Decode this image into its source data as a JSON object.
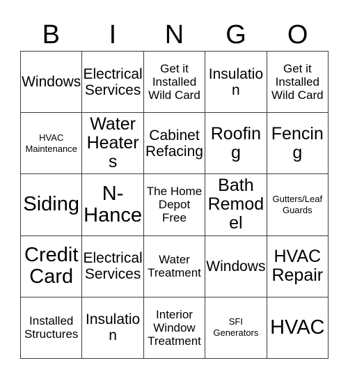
{
  "card": {
    "title": "Bingo Card",
    "header_letters": [
      "B",
      "I",
      "N",
      "G",
      "O"
    ],
    "colors": {
      "background": "#ffffff",
      "text": "#000000",
      "grid_line": "#3b3b3b"
    },
    "rows": [
      [
        {
          "text": "Windows",
          "size": "md"
        },
        {
          "text": "Electrical\nServices",
          "size": "md"
        },
        {
          "text": "Get it\nInstalled\nWild Card",
          "size": "sm"
        },
        {
          "text": "Insulation",
          "size": "md"
        },
        {
          "text": "Get it\nInstalled\nWild Card",
          "size": "sm"
        }
      ],
      [
        {
          "text": "HVAC\nMaintenance",
          "size": "xs"
        },
        {
          "text": "Water\nHeaters",
          "size": "lg"
        },
        {
          "text": "Cabinet\nRefacing",
          "size": "md"
        },
        {
          "text": "Roofing",
          "size": "lg"
        },
        {
          "text": "Fencing",
          "size": "lg"
        }
      ],
      [
        {
          "text": "Siding",
          "size": "xl"
        },
        {
          "text": "N-\nHance",
          "size": "xl"
        },
        {
          "text": "The Home\nDepot\nFree",
          "size": "sm"
        },
        {
          "text": "Bath\nRemodel",
          "size": "lg"
        },
        {
          "text": "Gutters/Leaf\nGuards",
          "size": "xs"
        }
      ],
      [
        {
          "text": "Credit\nCard",
          "size": "xl"
        },
        {
          "text": "Electrical\nServices",
          "size": "md"
        },
        {
          "text": "Water\nTreatment",
          "size": "sm"
        },
        {
          "text": "Windows",
          "size": "md"
        },
        {
          "text": "HVAC\nRepair",
          "size": "lg"
        }
      ],
      [
        {
          "text": "Installed\nStructures",
          "size": "sm"
        },
        {
          "text": "Insulation",
          "size": "md"
        },
        {
          "text": "Interior\nWindow\nTreatment",
          "size": "sm"
        },
        {
          "text": "SFI\nGenerators",
          "size": "xs"
        },
        {
          "text": "HVAC",
          "size": "xl"
        }
      ]
    ]
  }
}
